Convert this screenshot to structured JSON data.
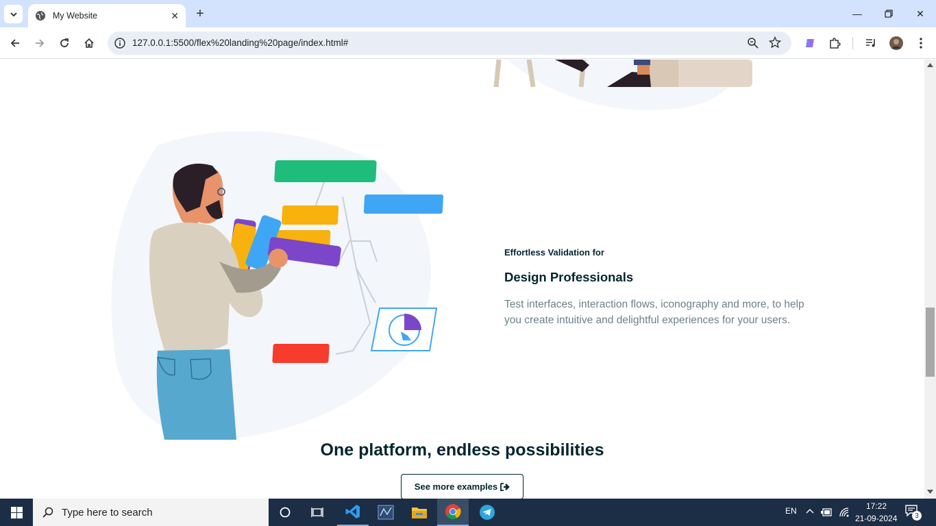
{
  "browser": {
    "tab_title": "My Website",
    "url": "127.0.0.1:5500/flex%20landing%20page/index.html#"
  },
  "features": {
    "subtitle": "Effortless Validation for",
    "title": "Design Professionals",
    "description": "Test interfaces, interaction flows, iconography and more, to help you create intuitive and delightful experiences for your users."
  },
  "platform": {
    "heading": "One platform, endless possibilities",
    "button_label": "See more examples"
  },
  "taskbar": {
    "search_placeholder": "Type here to search",
    "language": "EN",
    "time": "17:22",
    "date": "21-09-2024",
    "notifications": "3"
  },
  "colors": {
    "heading": "#00252e",
    "body_text": "#6d8188",
    "tabbar": "#d3e3fd",
    "taskbar": "#1c2e45"
  }
}
